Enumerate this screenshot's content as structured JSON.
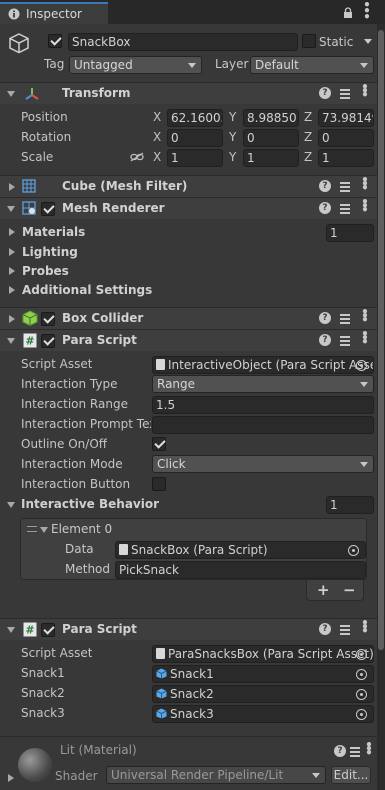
{
  "tab": {
    "title": "Inspector"
  },
  "object": {
    "name": "SnackBox",
    "static_label": "Static",
    "active": true,
    "static": false,
    "tag_label": "Tag",
    "tag_value": "Untagged",
    "layer_label": "Layer",
    "layer_value": "Default"
  },
  "transform": {
    "title": "Transform",
    "position_label": "Position",
    "rotation_label": "Rotation",
    "scale_label": "Scale",
    "pos": {
      "x": "62.16003",
      "y": "8.988501",
      "z": "73.98149"
    },
    "rot": {
      "x": "0",
      "y": "0",
      "z": "0"
    },
    "scl": {
      "x": "1",
      "y": "1",
      "z": "1"
    },
    "axis_x": "X",
    "axis_y": "Y",
    "axis_z": "Z"
  },
  "mesh_filter": {
    "title": "Cube (Mesh Filter)"
  },
  "mesh_renderer": {
    "title": "Mesh Renderer",
    "materials_label": "Materials",
    "materials_count": "1",
    "lighting_label": "Lighting",
    "probes_label": "Probes",
    "additional_label": "Additional Settings"
  },
  "box_collider": {
    "title": "Box Collider"
  },
  "para1": {
    "title": "Para Script",
    "script_asset_label": "Script Asset",
    "script_asset_value": "InteractiveObject (Para Script Asset)",
    "interaction_type_label": "Interaction Type",
    "interaction_type_value": "Range",
    "interaction_range_label": "Interaction Range",
    "interaction_range_value": "1.5",
    "prompt_label": "Interaction Prompt Text",
    "prompt_value": "",
    "outline_label": "Outline On/Off",
    "outline_checked": true,
    "mode_label": "Interaction Mode",
    "mode_value": "Click",
    "button_label": "Interaction Button",
    "button_checked": false,
    "behavior_label": "Interactive Behavior",
    "behavior_count": "1",
    "element_label": "Element 0",
    "data_label": "Data",
    "data_value": "SnackBox (Para Script)",
    "method_label": "Method N",
    "method_value": "PickSnack",
    "plus": "+",
    "minus": "−"
  },
  "para2": {
    "title": "Para Script",
    "script_asset_label": "Script Asset",
    "script_asset_value": "ParaSnacksBox (Para Script Asset)",
    "snack1_label": "Snack1",
    "snack1_value": "Snack1",
    "snack2_label": "Snack2",
    "snack2_value": "Snack2",
    "snack3_label": "Snack3",
    "snack3_value": "Snack3"
  },
  "material": {
    "title": "Lit (Material)",
    "shader_label": "Shader",
    "shader_value": "Universal Render Pipeline/Lit",
    "edit_label": "Edit..."
  },
  "colors": {
    "accent": "#3a79bb",
    "panel": "#383838",
    "header": "#3e3e3e",
    "field": "#2a2a2a"
  }
}
